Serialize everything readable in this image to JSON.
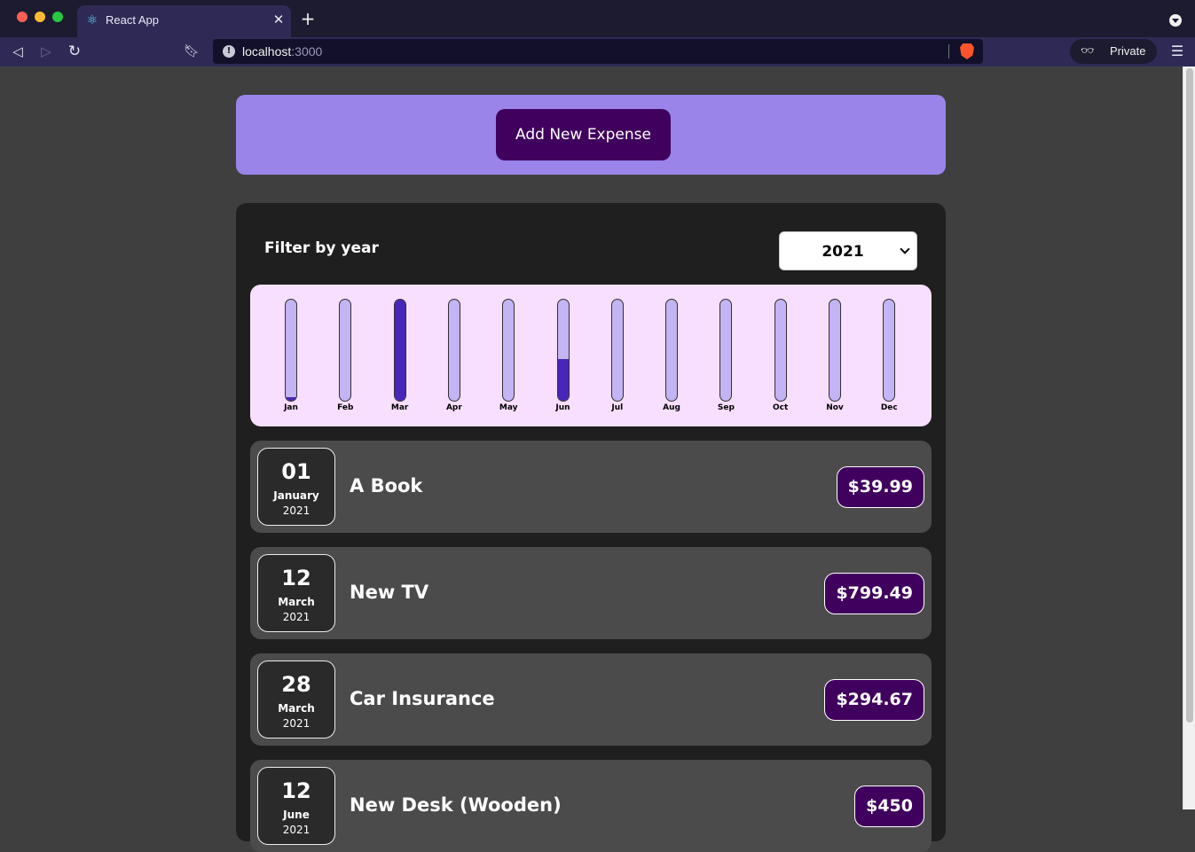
{
  "browser": {
    "tab_title": "React App",
    "url_host": "localhost",
    "url_port": ":3000",
    "private_label": "Private"
  },
  "new_expense": {
    "button_label": "Add New Expense"
  },
  "filter": {
    "label": "Filter by year",
    "selected_year": "2021"
  },
  "chart_data": {
    "type": "bar",
    "categories": [
      "Jan",
      "Feb",
      "Mar",
      "Apr",
      "May",
      "Jun",
      "Jul",
      "Aug",
      "Sep",
      "Oct",
      "Nov",
      "Dec"
    ],
    "values": [
      39.99,
      0,
      1094.16,
      0,
      0,
      450,
      0,
      0,
      0,
      0,
      0,
      0
    ],
    "ylim": [
      0,
      1094.16
    ],
    "title": "",
    "xlabel": "",
    "ylabel": "",
    "colors": {
      "track": "#c3b4f3",
      "fill": "#4826b9",
      "background": "#f8dfff"
    }
  },
  "expenses": [
    {
      "day": "01",
      "month": "January",
      "year": "2021",
      "title": "A Book",
      "amount": "$39.99"
    },
    {
      "day": "12",
      "month": "March",
      "year": "2021",
      "title": "New TV",
      "amount": "$799.49"
    },
    {
      "day": "28",
      "month": "March",
      "year": "2021",
      "title": "Car Insurance",
      "amount": "$294.67"
    },
    {
      "day": "12",
      "month": "June",
      "year": "2021",
      "title": "New Desk (Wooden)",
      "amount": "$450"
    }
  ]
}
